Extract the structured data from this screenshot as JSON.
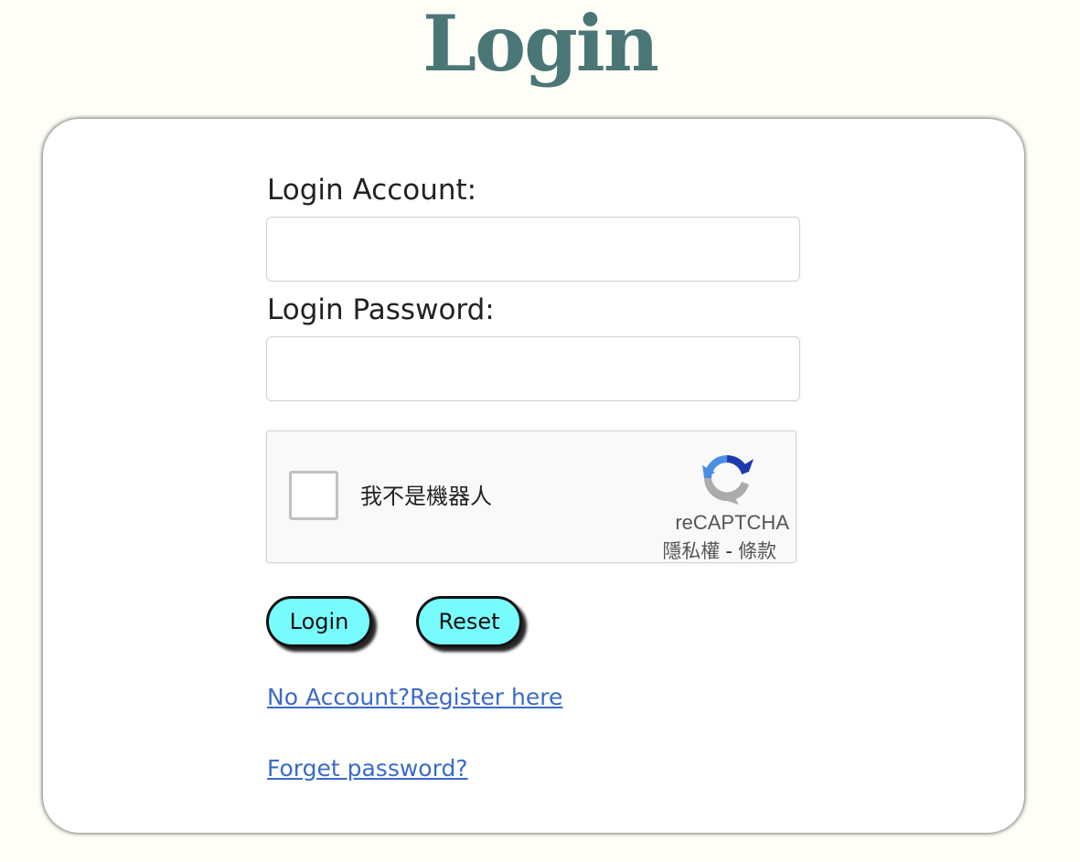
{
  "page": {
    "title": "Login"
  },
  "form": {
    "account_label": "Login Account:",
    "account_value": "",
    "password_label": "Login Password:",
    "password_value": ""
  },
  "recaptcha": {
    "checkbox_label": "我不是機器人",
    "brand": "reCAPTCHA",
    "privacy_link": "隱私權",
    "separator": "-",
    "terms_link": "條款",
    "checked": false
  },
  "buttons": {
    "login_label": "Login",
    "reset_label": "Reset"
  },
  "links": {
    "register": "No Account?Register here",
    "forgot": "Forget password?"
  },
  "colors": {
    "background": "#fefef6",
    "title": "#4b7676",
    "button_fill": "#78fbfc",
    "link": "#3a6bc7"
  },
  "icons": {
    "recaptcha_logo": "recaptcha-logo-icon"
  }
}
